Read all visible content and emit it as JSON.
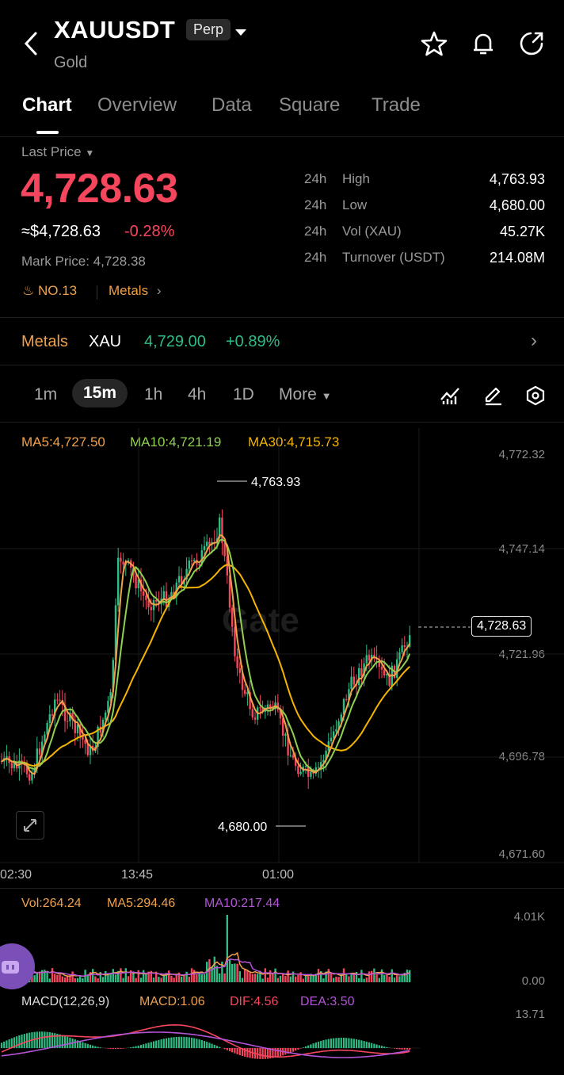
{
  "header": {
    "symbol": "XAUUSDT",
    "badge": "Perp",
    "subtitle": "Gold"
  },
  "tabs": [
    "Chart",
    "Overview",
    "Data",
    "Square",
    "Trade"
  ],
  "price": {
    "last_label": "Last Price",
    "last": "4,728.63",
    "usd": "≈$4,728.63",
    "change": "-0.28%",
    "mark": "Mark Price: 4,728.38",
    "rank": "NO.13",
    "category": "Metals"
  },
  "stats": [
    {
      "period": "24h",
      "label": "High",
      "value": "4,763.93"
    },
    {
      "period": "24h",
      "label": "Low",
      "value": "4,680.00"
    },
    {
      "period": "24h",
      "label": "Vol (XAU)",
      "value": "45.27K"
    },
    {
      "period": "24h",
      "label": "Turnover (USDT)",
      "value": "214.08M"
    }
  ],
  "related": {
    "category": "Metals",
    "symbol": "XAU",
    "price": "4,729.00",
    "change": "+0.89%"
  },
  "timeframes": {
    "items": [
      "1m",
      "15m",
      "1h",
      "4h",
      "1D"
    ],
    "more": "More"
  },
  "ma": {
    "ma5": "MA5:4,727.50",
    "ma10": "MA10:4,721.19",
    "ma30": "MA30:4,715.73"
  },
  "price_axis": [
    "4,772.32",
    "4,747.14",
    "4,721.96",
    "4,696.78",
    "4,671.60"
  ],
  "current_tag": "4,728.63",
  "annotations": {
    "high": "4,763.93",
    "low": "4,680.00"
  },
  "time_axis": [
    "02:30",
    "13:45",
    "01:00"
  ],
  "watermark": "Gate",
  "volume": {
    "vol": "Vol:264.24",
    "ma5": "MA5:294.46",
    "ma10": "MA10:217.44",
    "top": "4.01K",
    "bottom": "0.00"
  },
  "macd": {
    "label": "MACD(12,26,9)",
    "macd": "MACD:1.06",
    "dif": "DIF:4.56",
    "dea": "DEA:3.50",
    "top": "13.71"
  },
  "colors": {
    "up": "#2ebd85",
    "down": "#f6465d",
    "ma5": "#f0a04b",
    "ma10": "#8fd14f",
    "ma30": "#f4b400",
    "accent_orange": "#f0a04b",
    "purple": "#b454d6"
  }
}
